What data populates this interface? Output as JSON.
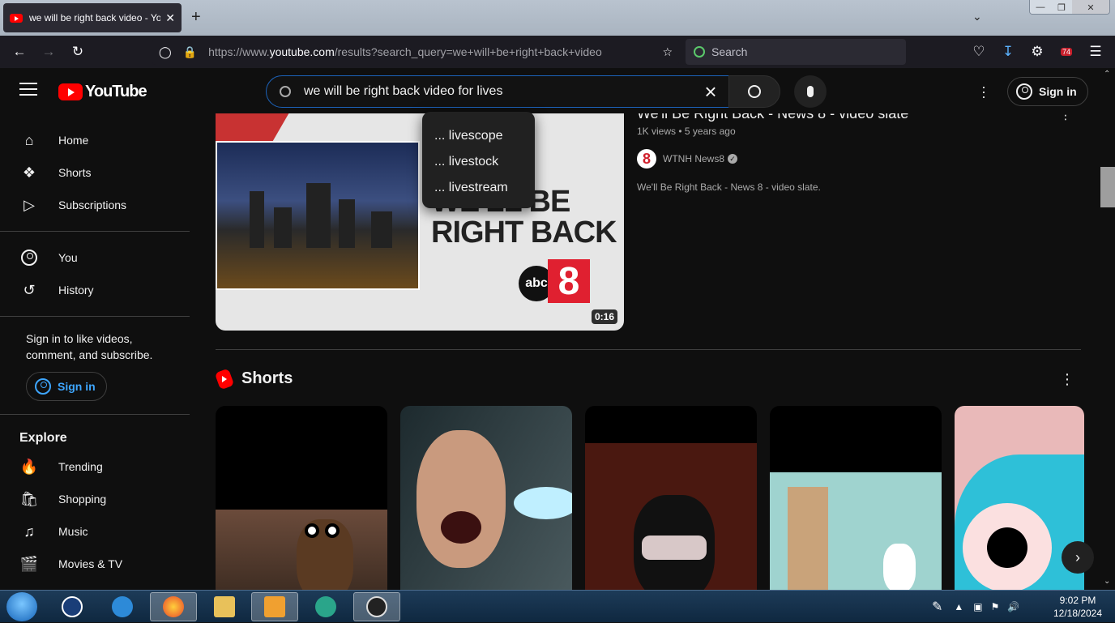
{
  "browser": {
    "tab_title": "we will be right back video - Yo",
    "tab_close": "✕",
    "new_tab": "+",
    "url_prefix": "https://www.",
    "url_domain": "youtube.com",
    "url_path": "/results?search_query=we+will+be+right+back+video",
    "search_placeholder": "Search",
    "extension_badge": "74"
  },
  "youtube": {
    "logo_text": "YouTube",
    "search_query": "we will be right back video for lives",
    "sign_in": "Sign in",
    "suggestions": [
      "... livescope",
      "... livestock",
      "... livestream"
    ]
  },
  "sidebar": {
    "main_items": [
      {
        "label": "Home",
        "icon": "home-icon"
      },
      {
        "label": "Shorts",
        "icon": "shorts-icon"
      },
      {
        "label": "Subscriptions",
        "icon": "subscriptions-icon"
      }
    ],
    "you_items": [
      {
        "label": "You",
        "icon": "you-icon"
      },
      {
        "label": "History",
        "icon": "history-icon"
      }
    ],
    "signin_prompt": "Sign in to like videos, comment, and subscribe.",
    "signin_button": "Sign in",
    "explore_title": "Explore",
    "explore_items": [
      {
        "label": "Trending",
        "icon": "trending-icon"
      },
      {
        "label": "Shopping",
        "icon": "shopping-icon"
      },
      {
        "label": "Music",
        "icon": "music-icon"
      },
      {
        "label": "Movies & TV",
        "icon": "movies-icon"
      }
    ]
  },
  "video": {
    "title": "We'll Be Right Back - News 8 - video slate",
    "views": "1K views",
    "age": "5 years ago",
    "channel": "WTNH News8",
    "description": "We'll Be Right Back - News 8 - video slate.",
    "duration": "0:16",
    "thumb_slate_line1": "WE'LL BE",
    "thumb_slate_line2": "RIGHT BACK",
    "thumb_abc": "abc",
    "thumb_8": "8"
  },
  "shorts": {
    "title": "Shorts"
  },
  "taskbar": {
    "time": "9:02 PM",
    "date": "12/18/2024"
  },
  "colors": {
    "accent_red": "#ff0000",
    "link_blue": "#3ea6ff",
    "search_border": "#1c62b9"
  }
}
